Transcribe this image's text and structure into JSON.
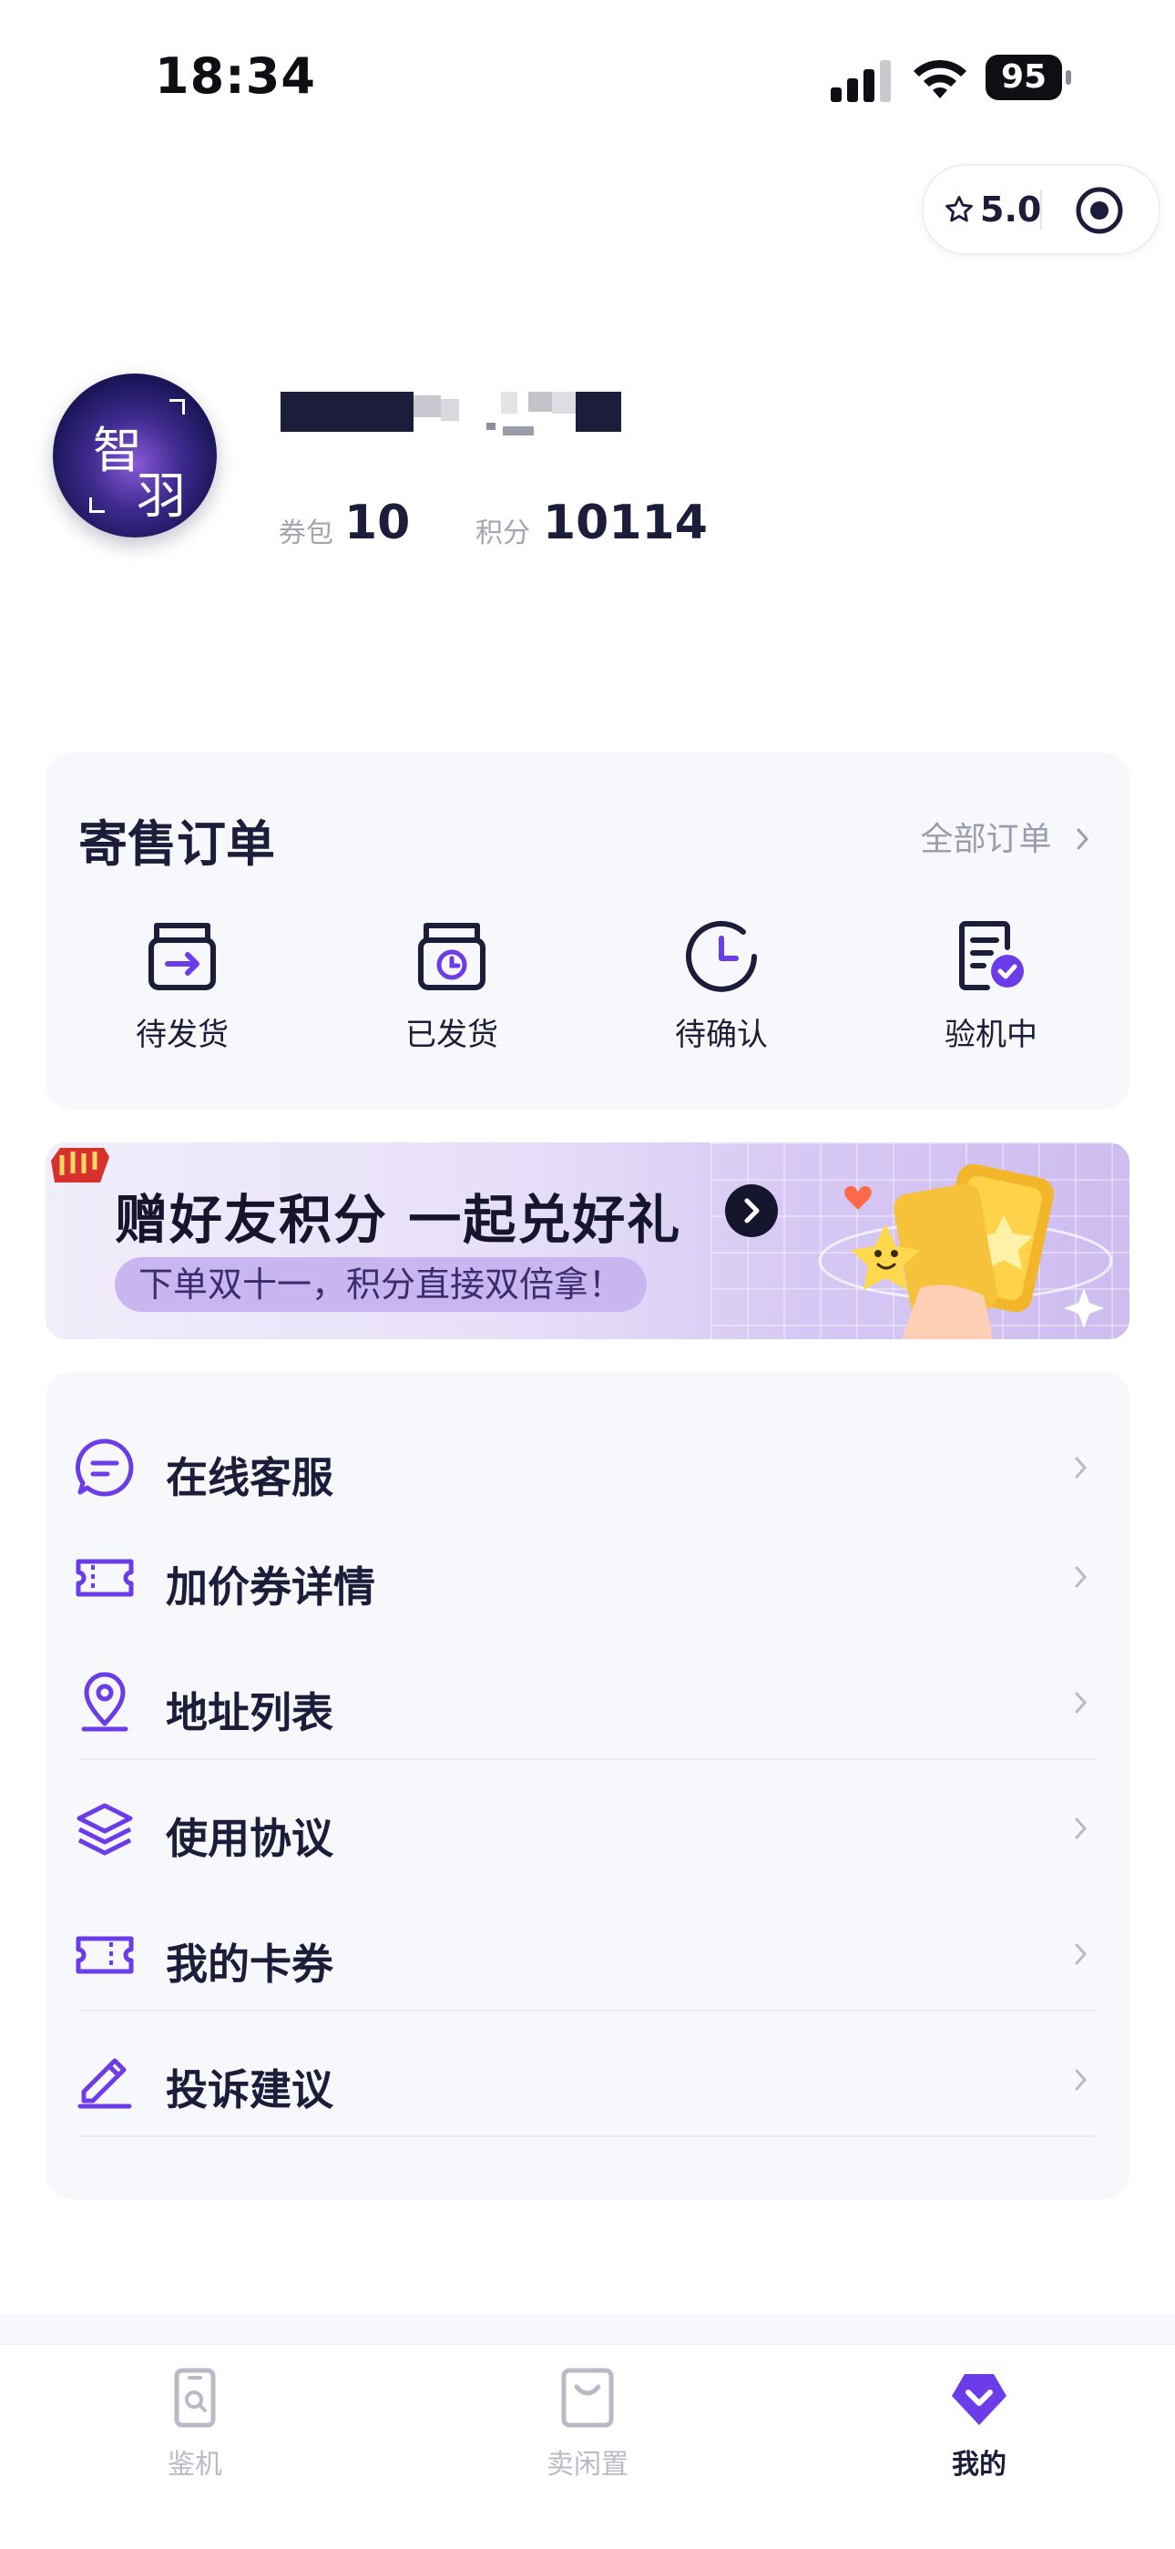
{
  "status_bar": {
    "time": "18:34",
    "battery": "95"
  },
  "capsule": {
    "rating": "5.0"
  },
  "profile": {
    "avatar_text_1": "智",
    "avatar_text_2": "羽",
    "coupon_label": "券包",
    "coupon_value": "10",
    "points_label": "积分",
    "points_value": "10114"
  },
  "orders": {
    "title": "寄售订单",
    "all_label": "全部订单",
    "items": [
      {
        "label": "待发货",
        "icon": "box-arrow-icon"
      },
      {
        "label": "已发货",
        "icon": "box-clock-icon"
      },
      {
        "label": "待确认",
        "icon": "clock-icon"
      },
      {
        "label": "验机中",
        "icon": "document-check-icon"
      }
    ]
  },
  "banner": {
    "title": "赠好友积分  一起兑好礼",
    "subtitle": "下单双十一，积分直接双倍拿！"
  },
  "menu": {
    "items": [
      {
        "label": "在线客服",
        "icon": "chat-bubble-icon"
      },
      {
        "label": "加价券详情",
        "icon": "ticket-icon"
      },
      {
        "label": "地址列表",
        "icon": "location-pin-icon"
      },
      {
        "label": "使用协议",
        "icon": "layers-icon"
      },
      {
        "label": "我的卡券",
        "icon": "ticket-icon"
      },
      {
        "label": "投诉建议",
        "icon": "edit-icon"
      }
    ]
  },
  "tabbar": {
    "tabs": [
      {
        "label": "鉴机",
        "active": false
      },
      {
        "label": "卖闲置",
        "active": false
      },
      {
        "label": "我的",
        "active": true
      }
    ]
  },
  "colors": {
    "accent": "#6c3ce9",
    "text": "#1b1d3a",
    "muted": "#9a9db0",
    "card": "#f7f8fb"
  }
}
